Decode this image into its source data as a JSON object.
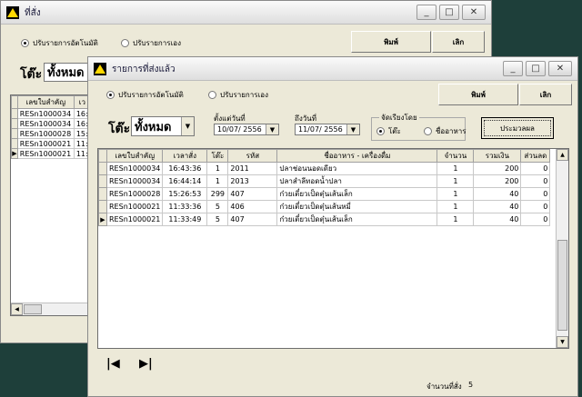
{
  "back_window": {
    "title": "ที่สั่ง",
    "radio_auto": "ปรับรายการอัตโนมัติ",
    "radio_manual": "ปรับรายการเอง",
    "print_label": "พิมพ์",
    "cancel_label": "เลิก",
    "table_label": "โต๊ะ",
    "table_value": "ทั้งหมด",
    "columns": [
      "เลขใบสำคัญ",
      "เว"
    ],
    "rows": [
      [
        "RESn1000034",
        "16:"
      ],
      [
        "RESn1000034",
        "16:"
      ],
      [
        "RESn1000028",
        "15:"
      ],
      [
        "RESn1000021",
        "11:"
      ],
      [
        "RESn1000021",
        "11:"
      ]
    ]
  },
  "front_window": {
    "title": "รายการที่ส่งแล้ว",
    "radio_auto": "ปรับรายการอัตโนมัติ",
    "radio_manual": "ปรับรายการเอง",
    "print_label": "พิมพ์",
    "cancel_label": "เลิก",
    "table_label": "โต๊ะ",
    "table_value": "ทั้งหมด",
    "from_date_label": "ตั้งแต่วันที่",
    "from_date": "10/07/ 2556",
    "to_date_label": "ถึงวันที่",
    "to_date": "11/07/ 2556",
    "sort_group_label": "จัดเรียงโดย",
    "sort_by_table": "โต๊ะ",
    "sort_by_food": "ชื่ออาหาร",
    "process_label": "ประมวลผล",
    "columns": [
      "เลขใบสำคัญ",
      "เวลาสั่ง",
      "โต๊ะ",
      "รหัส",
      "ชื่ออาหาร - เครื่องดื่ม",
      "จำนวน",
      "รวมเงิน",
      "ส่วนลด"
    ],
    "rows": [
      [
        "RESn1000034",
        "16:43:36",
        "1",
        "2011",
        "ปลาช่อนนอดเดียว",
        "1",
        "200",
        "0"
      ],
      [
        "RESn1000034",
        "16:44:14",
        "1",
        "2013",
        "ปลาสำลีทอดน้ำปลา",
        "1",
        "200",
        "0"
      ],
      [
        "RESn1000028",
        "15:26:53",
        "299",
        "407",
        "ก๋วยเตี๋ยวเป็ดตุ๋นเส้นเล็ก",
        "1",
        "40",
        "0"
      ],
      [
        "RESn1000021",
        "11:33:36",
        "5",
        "406",
        "ก๋วยเตี๋ยวเป็ดตุ๋นเส้นหมี่",
        "1",
        "40",
        "0"
      ],
      [
        "RESn1000021",
        "11:33:49",
        "5",
        "407",
        "ก๋วยเตี๋ยวเป็ดตุ๋นเส้นเล็ก",
        "1",
        "40",
        "0"
      ]
    ],
    "nav_first": "|◀",
    "nav_last": "▶|",
    "count_label": "จำนวนที่สั่ง",
    "count_value": "5"
  }
}
